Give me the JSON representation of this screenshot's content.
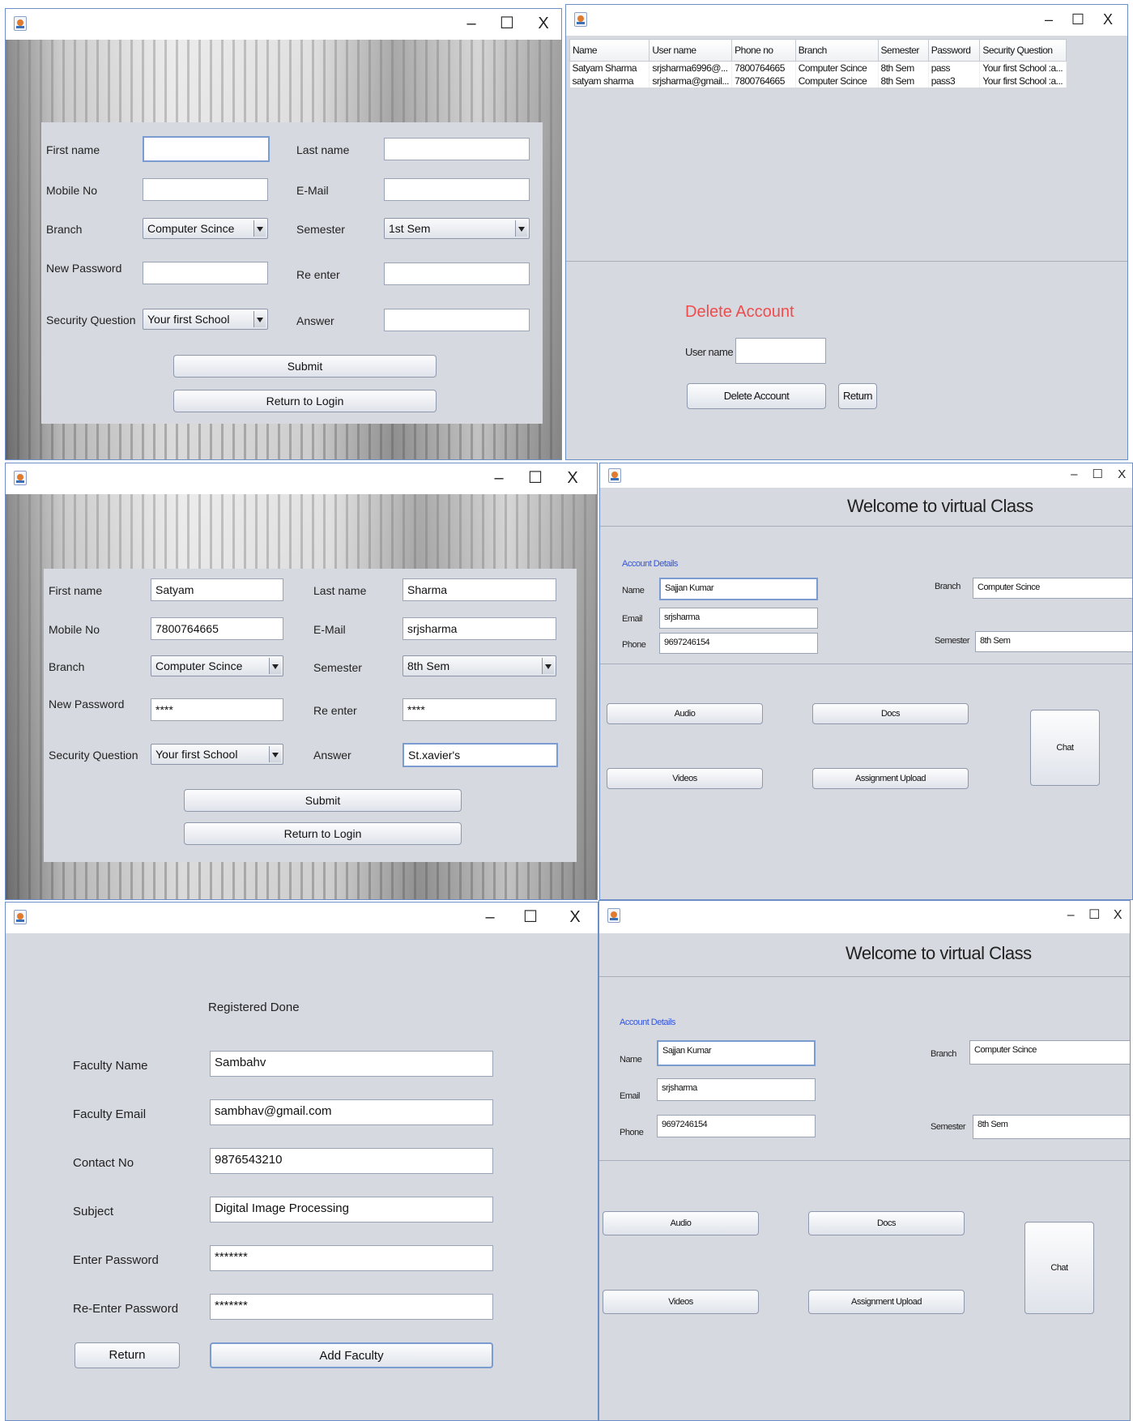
{
  "register_window": {
    "controls": {
      "minimize": "–",
      "maximize": "☐",
      "close": "X"
    },
    "labels": {
      "first_name": "First name",
      "last_name": "Last name",
      "mobile": "Mobile No",
      "email": "E-Mail",
      "branch": "Branch",
      "semester": "Semester",
      "new_password": "New Password",
      "re_enter": "Re enter",
      "security_question": "Security Question",
      "answer": "Answer"
    },
    "buttons": {
      "submit": "Submit",
      "return_login": "Return to Login"
    }
  },
  "register_empty": {
    "first_name": "",
    "last_name": "",
    "mobile": "",
    "email": "",
    "branch": "Computer Scince",
    "semester": "1st Sem",
    "new_password": "",
    "re_enter": "",
    "security_question": "Your first School",
    "answer": ""
  },
  "register_filled": {
    "first_name": "Satyam",
    "last_name": "Sharma",
    "mobile": "7800764665",
    "email": "srjsharma",
    "branch": "Computer Scince",
    "semester": "8th Sem",
    "new_password": "****",
    "re_enter": "****",
    "security_question": "Your first School",
    "answer": "St.xavier's"
  },
  "admin_window": {
    "columns": [
      "Name",
      "User name",
      "Phone no",
      "Branch",
      "Semester",
      "Password",
      "Security Question"
    ],
    "rows": [
      [
        "Satyam Sharma",
        "srjsharma6996@...",
        "7800764665",
        "Computer Scince",
        "8th Sem",
        "pass",
        "Your first School :a..."
      ],
      [
        "satyam sharma",
        "srjsharma@gmail...",
        "7800764665",
        "Computer Scince",
        "8th Sem",
        "pass3",
        "Your first School :a..."
      ]
    ],
    "delete_title": "Delete Account",
    "username_label": "User name",
    "username_value": "",
    "delete_button": "Delete Account",
    "return_button": "Return"
  },
  "welcome_window": {
    "title": "Welcome to virtual Class",
    "account_details": "Account Details",
    "labels": {
      "name": "Name",
      "email": "Email",
      "phone": "Phone",
      "branch": "Branch",
      "semester": "Semester"
    },
    "values": {
      "name": "Sajjan Kumar",
      "email": "srjsharma",
      "phone": "9697246154",
      "branch": "Computer Scince",
      "semester": "8th Sem"
    },
    "buttons": {
      "audio": "Audio",
      "docs": "Docs",
      "chat": "Chat",
      "videos": "Videos",
      "assignment": "Assignment Upload"
    }
  },
  "faculty_window": {
    "status": "Registered Done",
    "labels": {
      "name": "Faculty Name",
      "email": "Faculty Email",
      "contact": "Contact No",
      "subject": "Subject",
      "password": "Enter Password",
      "re_password": "Re-Enter Password"
    },
    "values": {
      "name": "Sambahv",
      "email": "sambhav@gmail.com",
      "contact": "9876543210",
      "subject": "Digital Image Processing",
      "password": "*******",
      "re_password": "*******"
    },
    "buttons": {
      "return": "Return",
      "add": "Add Faculty"
    }
  }
}
